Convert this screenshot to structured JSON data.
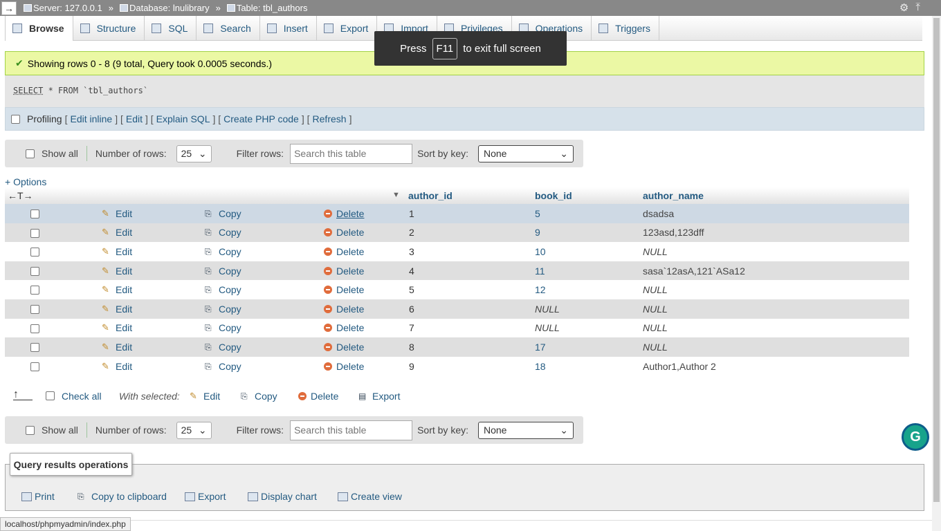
{
  "breadcrumb": {
    "back": "→",
    "server": "Server: 127.0.0.1",
    "database": "Database: lnulibrary",
    "table": "Table: tbl_authors",
    "sep": "»"
  },
  "tabs": [
    {
      "label": "Browse"
    },
    {
      "label": "Structure"
    },
    {
      "label": "SQL"
    },
    {
      "label": "Search"
    },
    {
      "label": "Insert"
    },
    {
      "label": "Export"
    },
    {
      "label": "Import"
    },
    {
      "label": "Privileges"
    },
    {
      "label": "Operations"
    },
    {
      "label": "Triggers"
    }
  ],
  "toast": {
    "pre": "Press",
    "key": "F11",
    "post": "to exit full screen"
  },
  "message": {
    "text": "Showing rows 0 - 8 (9 total, Query took 0.0005 seconds.)"
  },
  "sql": {
    "select": "SELECT",
    "rest": " * FROM `tbl_authors`"
  },
  "tools": {
    "profiling": "Profiling",
    "edit_inline": "Edit inline",
    "edit": "Edit",
    "explain": "Explain SQL",
    "create_php": "Create PHP code",
    "refresh": "Refresh",
    "lb": "[",
    "rb": "]",
    "mid": "] ["
  },
  "nav": {
    "show_all": "Show all",
    "num_rows_label": "Number of rows:",
    "num_rows_value": "25",
    "filter_label": "Filter rows:",
    "filter_placeholder": "Search this table",
    "sort_label": "Sort by key:",
    "sort_value": "None"
  },
  "options_link": "+ Options",
  "grid": {
    "arrows": "←T→",
    "columns": [
      "author_id",
      "book_id",
      "author_name"
    ],
    "actions": {
      "edit": "Edit",
      "copy": "Copy",
      "delete": "Delete"
    },
    "rows": [
      {
        "author_id": "1",
        "book_id": "5",
        "author_name": "dsadsa"
      },
      {
        "author_id": "2",
        "book_id": "9",
        "author_name": "123asd,123dff"
      },
      {
        "author_id": "3",
        "book_id": "10",
        "author_name": "NULL"
      },
      {
        "author_id": "4",
        "book_id": "11",
        "author_name": "sasa`12asA,121`ASa12"
      },
      {
        "author_id": "5",
        "book_id": "12",
        "author_name": "NULL"
      },
      {
        "author_id": "6",
        "book_id": "NULL",
        "author_name": "NULL"
      },
      {
        "author_id": "7",
        "book_id": "NULL",
        "author_name": "NULL"
      },
      {
        "author_id": "8",
        "book_id": "17",
        "author_name": "NULL"
      },
      {
        "author_id": "9",
        "book_id": "18",
        "author_name": "Author1,Author 2"
      }
    ]
  },
  "bulk": {
    "check_all": "Check all",
    "with_selected": "With selected:",
    "edit": "Edit",
    "copy": "Copy",
    "delete": "Delete",
    "export": "Export"
  },
  "qro": {
    "title": "Query results operations",
    "print": "Print",
    "copy_clipboard": "Copy to clipboard",
    "export": "Export",
    "display_chart": "Display chart",
    "create_view": "Create view"
  },
  "status_url": "localhost/phpmyadmin/index.php",
  "grammarly": "G"
}
